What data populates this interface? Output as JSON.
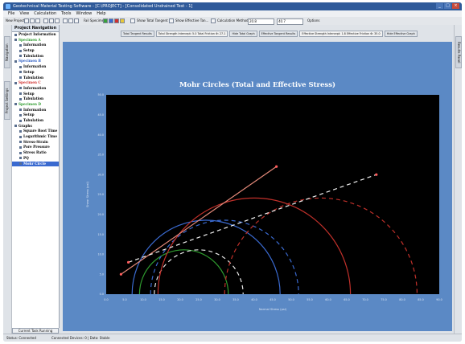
{
  "window": {
    "title": "Geotechnical Material Testing Software  -  [C:\\PROJECT]  -  [Consolidated Undrained Test - 1]"
  },
  "menu": [
    "File",
    "View",
    "Calculation",
    "Tools",
    "Window",
    "Help"
  ],
  "toolbar": {
    "new_project": "New Project",
    "fail_specimens": "Fail Specimens",
    "show_total_tangent": "Show Total Tangent",
    "show_effective_tan": "Show Effective Tan...",
    "calculation_method": "Calculation Method",
    "value1": "20.8",
    "value2": "40.7",
    "options": "Options"
  },
  "sidebar_tabs": [
    "Navigation",
    "Project Settings"
  ],
  "right_tab": "Results Panel",
  "nav": {
    "header": "Project Navigation",
    "items": [
      {
        "label": "Project Information",
        "level": 0,
        "color": "#000000"
      },
      {
        "label": "Specimen A",
        "level": 0,
        "color": "#2b9a2b"
      },
      {
        "label": "Information",
        "level": 1,
        "color": "#000000"
      },
      {
        "label": "Setup",
        "level": 1,
        "color": "#000000"
      },
      {
        "label": "Tabulation",
        "level": 1,
        "color": "#000000"
      },
      {
        "label": "Specimen B",
        "level": 0,
        "color": "#2f5fc4"
      },
      {
        "label": "Information",
        "level": 1,
        "color": "#000000"
      },
      {
        "label": "Setup",
        "level": 1,
        "color": "#000000"
      },
      {
        "label": "Tabulation",
        "level": 1,
        "color": "#000000"
      },
      {
        "label": "Specimen C",
        "level": 0,
        "color": "#d0302f"
      },
      {
        "label": "Information",
        "level": 1,
        "color": "#000000"
      },
      {
        "label": "Setup",
        "level": 1,
        "color": "#000000"
      },
      {
        "label": "Tabulation",
        "level": 1,
        "color": "#000000"
      },
      {
        "label": "Specimen D",
        "level": 0,
        "color": "#2b9a2b"
      },
      {
        "label": "Information",
        "level": 1,
        "color": "#000000"
      },
      {
        "label": "Setup",
        "level": 1,
        "color": "#000000"
      },
      {
        "label": "Tabulation",
        "level": 1,
        "color": "#000000"
      },
      {
        "label": "Graphs",
        "level": 0,
        "color": "#000000"
      },
      {
        "label": "Square Root Time",
        "level": 1,
        "color": "#000000"
      },
      {
        "label": "Logarithmic Time",
        "level": 1,
        "color": "#000000"
      },
      {
        "label": "Stress-Strain",
        "level": 1,
        "color": "#000000"
      },
      {
        "label": "Pore Pressure",
        "level": 1,
        "color": "#000000"
      },
      {
        "label": "Stress Ratio",
        "level": 1,
        "color": "#000000"
      },
      {
        "label": "PQ",
        "level": 1,
        "color": "#000000"
      },
      {
        "label": "Mohr Circle",
        "level": 1,
        "color": "#ffffff",
        "selected": true
      }
    ],
    "bottom_tab": "Current Task Running"
  },
  "results_strip": [
    "Total Tangent Results",
    "Total Strength Intercept: 5.0 Total Friction Φ: 27.1",
    "Hide Total Graph",
    "Effective Tangent Results",
    "Effective Strength Intercept: 1.8 Effective Friction Φ: 35.0",
    "Hide Effective Graph"
  ],
  "status": {
    "left": "Status: Connected",
    "right": "Connected Devices: 0  |  Data: Stable"
  },
  "chart_data": {
    "type": "scatter",
    "title": "Mohr Circles (Total and Effective Stress)",
    "xlabel": "Normal Stress (psi)",
    "ylabel": "Shear Stress (psi)",
    "xlim": [
      0,
      90
    ],
    "ylim": [
      0,
      50
    ],
    "xticks": [
      0,
      5,
      10,
      15,
      20,
      25,
      30,
      35,
      40,
      45,
      50,
      55,
      60,
      65,
      70,
      75,
      80,
      85,
      90
    ],
    "yticks": [
      0,
      5,
      10,
      15,
      20,
      25,
      30,
      35,
      40,
      45,
      50
    ],
    "grid": false,
    "colors": {
      "background": "#000000",
      "page": "#5b89c5",
      "total_line": "#e58a7a",
      "effective_line": "#f2f2f2"
    },
    "circles": [
      {
        "center": 21,
        "radius": 12,
        "style": "solid",
        "color": "#2f9c2f"
      },
      {
        "center": 25,
        "radius": 12,
        "style": "dashed",
        "color": "#e8e8e8"
      },
      {
        "center": 27,
        "radius": 20,
        "style": "solid",
        "color": "#3a6ad0"
      },
      {
        "center": 32,
        "radius": 20,
        "style": "dashed",
        "color": "#3a6ad0"
      },
      {
        "center": 40,
        "radius": 26,
        "style": "solid",
        "color": "#c0302a"
      },
      {
        "center": 58,
        "radius": 26,
        "style": "dashed",
        "color": "#c0302a"
      }
    ],
    "envelopes": [
      {
        "name": "Total",
        "x": [
          4,
          46
        ],
        "y": [
          5,
          32
        ],
        "style": "solid",
        "color": "#e58a7a"
      },
      {
        "name": "Effective",
        "x": [
          6,
          73
        ],
        "y": [
          8,
          30
        ],
        "style": "dashed",
        "color": "#f2f2f2"
      }
    ]
  }
}
